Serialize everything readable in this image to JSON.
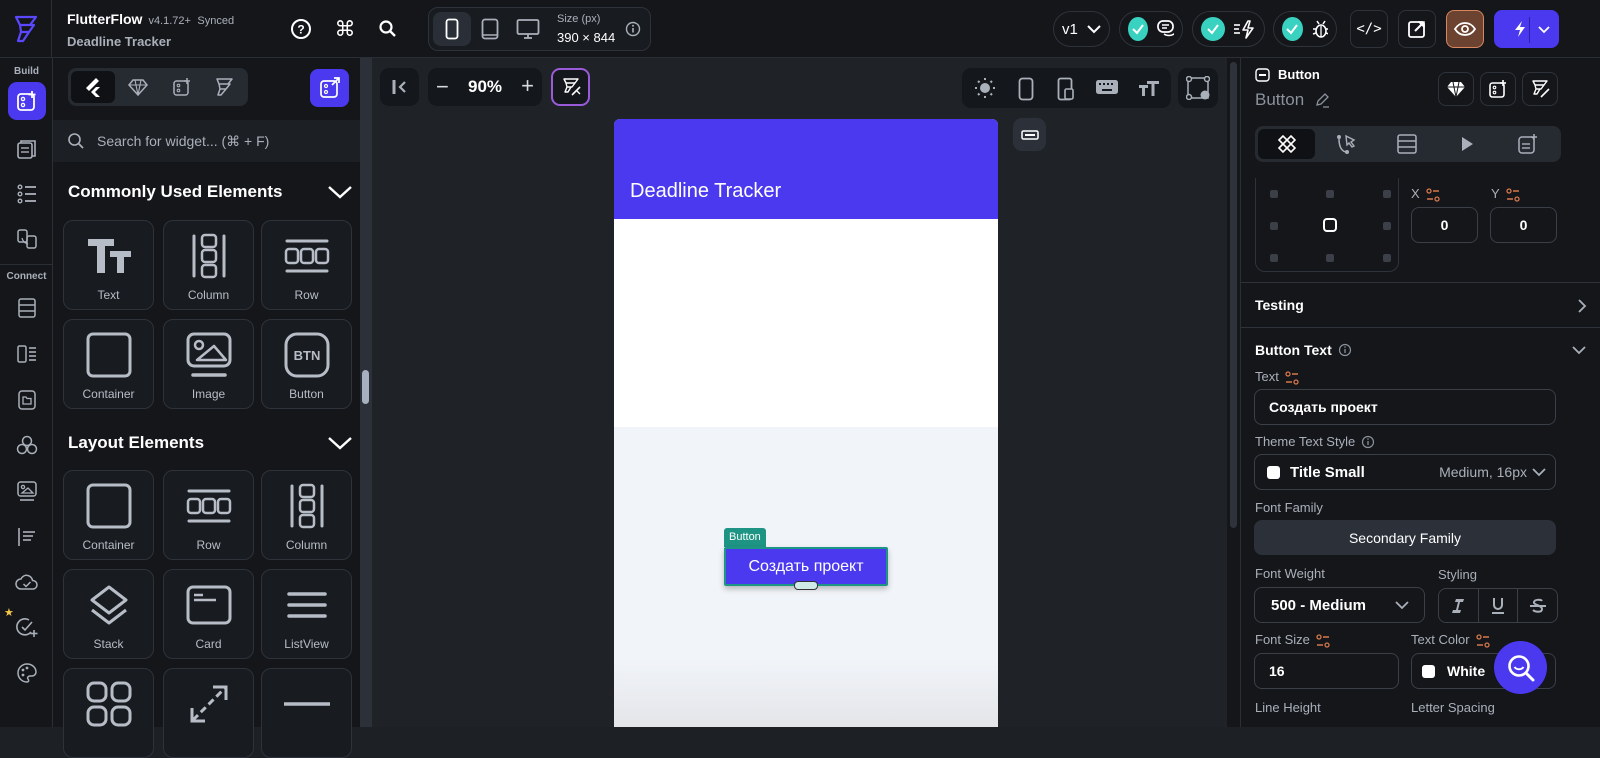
{
  "topbar": {
    "app_name": "FlutterFlow",
    "version": "v4.1.72+",
    "sync_status": "Synced",
    "project_name": "Deadline Tracker",
    "size_label": "Size (px)",
    "size_value": "390 × 844",
    "version_select": "v1",
    "colors": {
      "accent": "#4b39ef",
      "check": "#39d2c0",
      "preview_active": "#6b4330"
    }
  },
  "leftrail": {
    "build_label": "Build",
    "connect_label": "Connect"
  },
  "widget_panel": {
    "search_placeholder": "Search for widget... (⌘ + F)",
    "sections": [
      {
        "title": "Commonly Used Elements",
        "items": [
          "Text",
          "Column",
          "Row",
          "Container",
          "Image",
          "Button"
        ]
      },
      {
        "title": "Layout Elements",
        "items": [
          "Container",
          "Row",
          "Column",
          "Stack",
          "Card",
          "ListView"
        ]
      }
    ]
  },
  "canvas": {
    "zoom": "90%",
    "app_bar_title": "Deadline Tracker",
    "selected_tag": "Button",
    "button_label": "Создать проект"
  },
  "properties": {
    "widget_type": "Button",
    "widget_name": "Button",
    "x_label": "X",
    "y_label": "Y",
    "x_value": "0",
    "y_value": "0",
    "testing_label": "Testing",
    "button_text_section": "Button Text",
    "text_label": "Text",
    "text_value": "Создать проект",
    "theme_style_label": "Theme Text Style",
    "theme_style_value": "Title Small",
    "theme_style_meta": "Medium, 16px",
    "font_family_label": "Font Family",
    "font_family_value": "Secondary Family",
    "font_weight_label": "Font Weight",
    "font_weight_value": "500 - Medium",
    "styling_label": "Styling",
    "font_size_label": "Font Size",
    "font_size_value": "16",
    "text_color_label": "Text Color",
    "text_color_value": "White",
    "line_height_label": "Line Height",
    "letter_spacing_label": "Letter Spacing"
  }
}
